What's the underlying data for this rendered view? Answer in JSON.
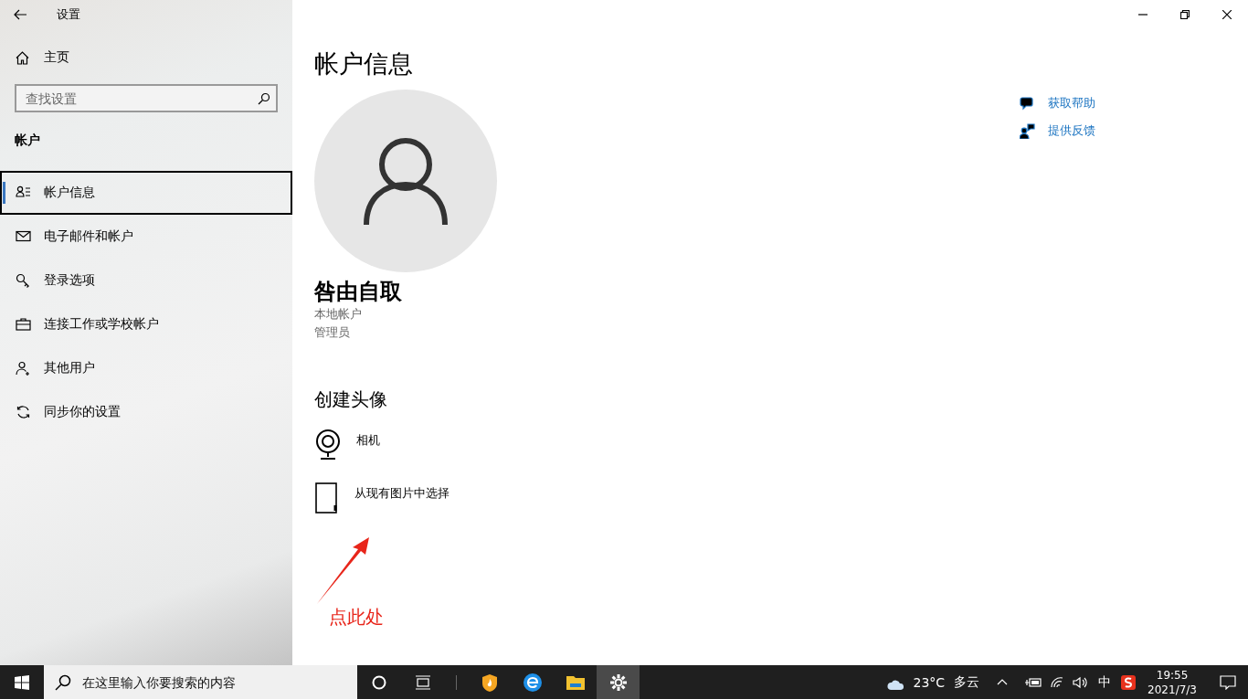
{
  "window": {
    "title": "设置"
  },
  "sidebar": {
    "home": "主页",
    "search": {
      "placeholder": "查找设置"
    },
    "section": "帐户",
    "items": [
      {
        "label": "帐户信息",
        "selected": true
      },
      {
        "label": "电子邮件和帐户",
        "selected": false
      },
      {
        "label": "登录选项",
        "selected": false
      },
      {
        "label": "连接工作或学校帐户",
        "selected": false
      },
      {
        "label": "其他用户",
        "selected": false
      },
      {
        "label": "同步你的设置",
        "selected": false
      }
    ]
  },
  "main": {
    "title": "帐户信息",
    "user_name": "咎由自取",
    "account_type": "本地帐户",
    "role": "管理员",
    "section": "创建头像",
    "options": [
      {
        "label": "相机"
      },
      {
        "label": "从现有图片中选择"
      }
    ],
    "links": [
      {
        "label": "获取帮助"
      },
      {
        "label": "提供反馈"
      }
    ],
    "annotation": "点此处"
  },
  "taskbar": {
    "search": {
      "placeholder": "在这里输入你要搜索的内容"
    },
    "apps": [
      {
        "selected": false
      },
      {
        "selected": false
      },
      {
        "selected": false
      },
      {
        "selected": true
      }
    ],
    "temperature": "23°C",
    "weather": "多云",
    "ime": "中",
    "time": "19:55",
    "date": "2021/7/3"
  }
}
